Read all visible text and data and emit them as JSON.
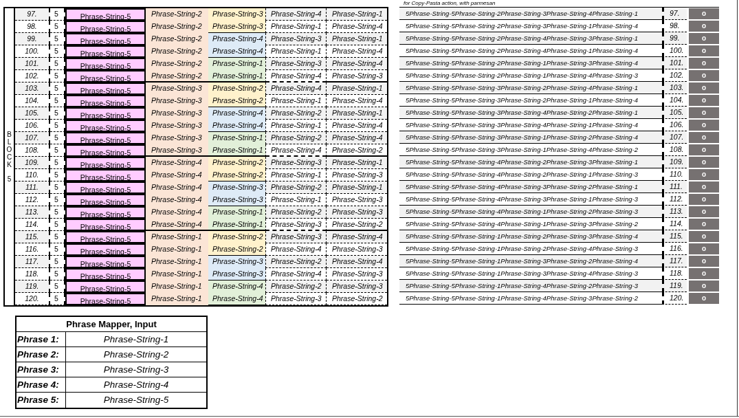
{
  "note": "for Copy-Pasta action, with parmesan",
  "block": {
    "label": "BLOCK",
    "number": "5"
  },
  "rows": [
    {
      "num": "97.",
      "block": "5",
      "p1": "Phrase-String-5",
      "p2": "Phrase-String-2",
      "p3": {
        "text": "Phrase-String-3",
        "color": "#fff2cc"
      },
      "p4": "Phrase-String-4",
      "p5": "Phrase-String-1",
      "concat": "5Phrase-String-5Phrase-String-2Phrase-String-3Phrase-String-4Phrase-String-1",
      "num2": "97.",
      "button": "o"
    },
    {
      "num": "98.",
      "block": "5",
      "p1": "Phrase-String-5",
      "p2": "Phrase-String-2",
      "p3": {
        "text": "Phrase-String-3",
        "color": "#fff2cc"
      },
      "p4": "Phrase-String-1",
      "p5": "Phrase-String-4",
      "concat": "5Phrase-String-5Phrase-String-2Phrase-String-3Phrase-String-1Phrase-String-4",
      "num2": "98.",
      "button": "o"
    },
    {
      "num": "99.",
      "block": "5",
      "p1": "Phrase-String-5",
      "p2": "Phrase-String-2",
      "p3": {
        "text": "Phrase-String-4",
        "color": "#deebf7"
      },
      "p4": "Phrase-String-3",
      "p5": "Phrase-String-1",
      "concat": "5Phrase-String-5Phrase-String-2Phrase-String-4Phrase-String-3Phrase-String-1",
      "num2": "99.",
      "button": "o"
    },
    {
      "num": "100.",
      "block": "5",
      "p1": "Phrase-String-5",
      "p2": "Phrase-String-2",
      "p3": {
        "text": "Phrase-String-4",
        "color": "#deebf7"
      },
      "p4": "Phrase-String-1",
      "p5": "Phrase-String-4",
      "concat": "5Phrase-String-5Phrase-String-2Phrase-String-4Phrase-String-1Phrase-String-4",
      "num2": "100.",
      "button": "o"
    },
    {
      "num": "101.",
      "block": "5",
      "p1": "Phrase-String-5",
      "p2": "Phrase-String-2",
      "p3": {
        "text": "Phrase-String-1",
        "color": "#e2f0d9"
      },
      "p4": "Phrase-String-3",
      "p5": "Phrase-String-4",
      "concat": "5Phrase-String-5Phrase-String-2Phrase-String-1Phrase-String-3Phrase-String-4",
      "num2": "101.",
      "button": "o"
    },
    {
      "num": "102.",
      "block": "5",
      "p1": "Phrase-String-5",
      "p2": "Phrase-String-2",
      "p3": {
        "text": "Phrase-String-1",
        "color": "#e2f0d9"
      },
      "p4": "Phrase-String-4",
      "p5": "Phrase-String-3",
      "concat": "5Phrase-String-5Phrase-String-2Phrase-String-1Phrase-String-4Phrase-String-3",
      "num2": "102.",
      "button": "o"
    },
    {
      "num": "103.",
      "block": "5",
      "p1": "Phrase-String-5",
      "p2": "Phrase-String-3",
      "p3": {
        "text": "Phrase-String-2",
        "color": "#fff2cc"
      },
      "p4": "Phrase-String-4",
      "p5": "Phrase-String-1",
      "concat": "5Phrase-String-5Phrase-String-3Phrase-String-2Phrase-String-4Phrase-String-1",
      "num2": "103.",
      "button": "o"
    },
    {
      "num": "104.",
      "block": "5",
      "p1": "Phrase-String-5",
      "p2": "Phrase-String-3",
      "p3": {
        "text": "Phrase-String-2",
        "color": "#fff2cc"
      },
      "p4": "Phrase-String-1",
      "p5": "Phrase-String-4",
      "concat": "5Phrase-String-5Phrase-String-3Phrase-String-2Phrase-String-1Phrase-String-4",
      "num2": "104.",
      "button": "o"
    },
    {
      "num": "105.",
      "block": "5",
      "p1": "Phrase-String-5",
      "p2": "Phrase-String-3",
      "p3": {
        "text": "Phrase-String-4",
        "color": "#deebf7"
      },
      "p4": "Phrase-String-2",
      "p5": "Phrase-String-1",
      "concat": "5Phrase-String-5Phrase-String-3Phrase-String-4Phrase-String-2Phrase-String-1",
      "num2": "105.",
      "button": "o"
    },
    {
      "num": "106.",
      "block": "5",
      "p1": "Phrase-String-5",
      "p2": "Phrase-String-3",
      "p3": {
        "text": "Phrase-String-4",
        "color": "#deebf7"
      },
      "p4": "Phrase-String-1",
      "p5": "Phrase-String-4",
      "concat": "5Phrase-String-5Phrase-String-3Phrase-String-4Phrase-String-1Phrase-String-4",
      "num2": "106.",
      "button": "o"
    },
    {
      "num": "107.",
      "block": "5",
      "p1": "Phrase-String-5",
      "p2": "Phrase-String-3",
      "p3": {
        "text": "Phrase-String-1",
        "color": "#e2f0d9"
      },
      "p4": "Phrase-String-2",
      "p5": "Phrase-String-4",
      "concat": "5Phrase-String-5Phrase-String-3Phrase-String-1Phrase-String-2Phrase-String-4",
      "num2": "107.",
      "button": "o"
    },
    {
      "num": "108.",
      "block": "5",
      "p1": "Phrase-String-5",
      "p2": "Phrase-String-3",
      "p3": {
        "text": "Phrase-String-1",
        "color": "#e2f0d9"
      },
      "p4": "Phrase-String-4",
      "p5": "Phrase-String-2",
      "concat": "5Phrase-String-5Phrase-String-3Phrase-String-1Phrase-String-4Phrase-String-2",
      "num2": "108.",
      "button": "o"
    },
    {
      "num": "109.",
      "block": "5",
      "p1": "Phrase-String-5",
      "p2": "Phrase-String-4",
      "p3": {
        "text": "Phrase-String-2",
        "color": "#fff2cc"
      },
      "p4": "Phrase-String-3",
      "p5": "Phrase-String-1",
      "concat": "5Phrase-String-5Phrase-String-4Phrase-String-2Phrase-String-3Phrase-String-1",
      "num2": "109.",
      "button": "o"
    },
    {
      "num": "110.",
      "block": "5",
      "p1": "Phrase-String-5",
      "p2": "Phrase-String-4",
      "p3": {
        "text": "Phrase-String-2",
        "color": "#fff2cc"
      },
      "p4": "Phrase-String-1",
      "p5": "Phrase-String-3",
      "concat": "5Phrase-String-5Phrase-String-4Phrase-String-2Phrase-String-1Phrase-String-3",
      "num2": "110.",
      "button": "o"
    },
    {
      "num": "111.",
      "block": "5",
      "p1": "Phrase-String-5",
      "p2": "Phrase-String-4",
      "p3": {
        "text": "Phrase-String-3",
        "color": "#deebf7"
      },
      "p4": "Phrase-String-2",
      "p5": "Phrase-String-1",
      "concat": "5Phrase-String-5Phrase-String-4Phrase-String-3Phrase-String-2Phrase-String-1",
      "num2": "111.",
      "button": "o"
    },
    {
      "num": "112.",
      "block": "5",
      "p1": "Phrase-String-5",
      "p2": "Phrase-String-4",
      "p3": {
        "text": "Phrase-String-3",
        "color": "#deebf7"
      },
      "p4": "Phrase-String-1",
      "p5": "Phrase-String-3",
      "concat": "5Phrase-String-5Phrase-String-4Phrase-String-3Phrase-String-1Phrase-String-3",
      "num2": "112.",
      "button": "o"
    },
    {
      "num": "113.",
      "block": "5",
      "p1": "Phrase-String-5",
      "p2": "Phrase-String-4",
      "p3": {
        "text": "Phrase-String-1",
        "color": "#e2f0d9"
      },
      "p4": "Phrase-String-2",
      "p5": "Phrase-String-3",
      "concat": "5Phrase-String-5Phrase-String-4Phrase-String-1Phrase-String-2Phrase-String-3",
      "num2": "113.",
      "button": "o"
    },
    {
      "num": "114.",
      "block": "5",
      "p1": "Phrase-String-5",
      "p2": "Phrase-String-4",
      "p3": {
        "text": "Phrase-String-1",
        "color": "#e2f0d9"
      },
      "p4": "Phrase-String-3",
      "p5": "Phrase-String-2",
      "concat": "5Phrase-String-5Phrase-String-4Phrase-String-1Phrase-String-3Phrase-String-2",
      "num2": "114.",
      "button": "o"
    },
    {
      "num": "115.",
      "block": "5",
      "p1": "Phrase-String-5",
      "p2": "Phrase-String-1",
      "p3": {
        "text": "Phrase-String-2",
        "color": "#fff2cc"
      },
      "p4": "Phrase-String-3",
      "p5": "Phrase-String-4",
      "concat": "5Phrase-String-5Phrase-String-1Phrase-String-2Phrase-String-3Phrase-String-4",
      "num2": "115.",
      "button": "o"
    },
    {
      "num": "116.",
      "block": "5",
      "p1": "Phrase-String-5",
      "p2": "Phrase-String-1",
      "p3": {
        "text": "Phrase-String-2",
        "color": "#fff2cc"
      },
      "p4": "Phrase-String-4",
      "p5": "Phrase-String-3",
      "concat": "5Phrase-String-5Phrase-String-1Phrase-String-2Phrase-String-4Phrase-String-3",
      "num2": "116.",
      "button": "o"
    },
    {
      "num": "117.",
      "block": "5",
      "p1": "Phrase-String-5",
      "p2": "Phrase-String-1",
      "p3": {
        "text": "Phrase-String-3",
        "color": "#deebf7"
      },
      "p4": "Phrase-String-2",
      "p5": "Phrase-String-4",
      "concat": "5Phrase-String-5Phrase-String-1Phrase-String-3Phrase-String-2Phrase-String-4",
      "num2": "117.",
      "button": "o"
    },
    {
      "num": "118.",
      "block": "5",
      "p1": "Phrase-String-5",
      "p2": "Phrase-String-1",
      "p3": {
        "text": "Phrase-String-3",
        "color": "#deebf7"
      },
      "p4": "Phrase-String-4",
      "p5": "Phrase-String-3",
      "concat": "5Phrase-String-5Phrase-String-1Phrase-String-3Phrase-String-4Phrase-String-3",
      "num2": "118.",
      "button": "o"
    },
    {
      "num": "119.",
      "block": "5",
      "p1": "Phrase-String-5",
      "p2": "Phrase-String-1",
      "p3": {
        "text": "Phrase-String-4",
        "color": "#e2f0d9"
      },
      "p4": "Phrase-String-2",
      "p5": "Phrase-String-3",
      "concat": "5Phrase-String-5Phrase-String-1Phrase-String-4Phrase-String-2Phrase-String-3",
      "num2": "119.",
      "button": "o"
    },
    {
      "num": "120.",
      "block": "5",
      "p1": "Phrase-String-5",
      "p2": "Phrase-String-1",
      "p3": {
        "text": "Phrase-String-4",
        "color": "#e2f0d9"
      },
      "p4": "Phrase-String-3",
      "p5": "Phrase-String-2",
      "concat": "5Phrase-String-5Phrase-String-1Phrase-String-4Phrase-String-3Phrase-String-2",
      "num2": "120.",
      "button": "o"
    }
  ],
  "mapper": {
    "title": "Phrase Mapper, Input",
    "rows": [
      {
        "label": "Phrase 1:",
        "value": "Phrase-String-1"
      },
      {
        "label": "Phrase 2:",
        "value": "Phrase-String-2"
      },
      {
        "label": "Phrase 3:",
        "value": "Phrase-String-3"
      },
      {
        "label": "Phrase 4:",
        "value": "Phrase-String-4"
      },
      {
        "label": "Phrase 5:",
        "value": "Phrase-String-5"
      }
    ]
  }
}
